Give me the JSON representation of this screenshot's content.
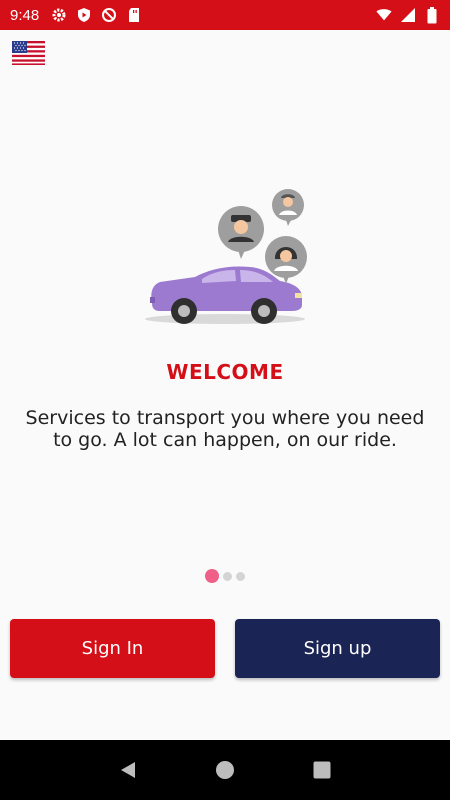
{
  "status_bar": {
    "time": "9:48",
    "left_icons": [
      "settings-icon",
      "shield-play-icon",
      "vpn-blocked-icon",
      "sd-card-icon"
    ],
    "right_icons": [
      "wifi-icon",
      "signal-icon",
      "battery-icon"
    ],
    "background": "#d50f17"
  },
  "language": {
    "flag": "us-flag-icon"
  },
  "welcome": {
    "title": "WELCOME",
    "text": "Services to transport you where you need to go. A lot can happen, on our ride."
  },
  "pager": {
    "total": 3,
    "active_index": 0
  },
  "buttons": {
    "sign_in": "Sign In",
    "sign_up": "Sign up"
  },
  "colors": {
    "primary_red": "#d50f17",
    "navy": "#1a2455",
    "car_purple": "#9c7ad0",
    "pager_active": "#ef5f87"
  },
  "nav_bar": {
    "buttons": [
      "back-icon",
      "home-icon",
      "recents-icon"
    ]
  }
}
